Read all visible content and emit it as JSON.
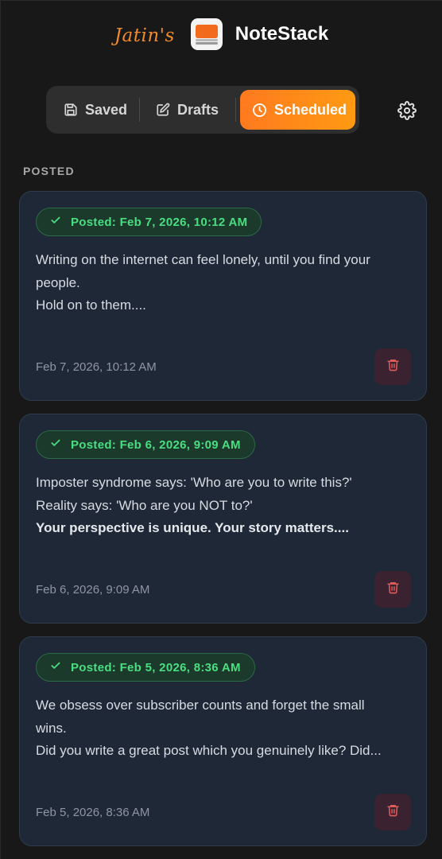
{
  "header": {
    "owner": "Jatin's",
    "title": "NoteStack"
  },
  "tabs": [
    {
      "label": "Saved",
      "icon": "save-icon"
    },
    {
      "label": "Drafts",
      "icon": "edit-icon"
    },
    {
      "label": "Scheduled",
      "icon": "clock-icon",
      "active": true
    }
  ],
  "section_label": "POSTED",
  "colors": {
    "accent": "#ff8a1a",
    "card_bg": "#1f2837",
    "posted_green": "#4ade80",
    "delete_red": "#e05a5a"
  },
  "posts": [
    {
      "status": "Posted: Feb 7, 2026, 10:12 AM",
      "lines": [
        {
          "text": "Writing on the internet can feel lonely, until you find your"
        },
        {
          "text": "people."
        },
        {
          "text": "Hold on to them...."
        }
      ],
      "timestamp": "Feb 7, 2026, 10:12 AM"
    },
    {
      "status": "Posted: Feb 6, 2026, 9:09 AM",
      "lines": [
        {
          "text": "Imposter syndrome says: 'Who are you to write this?'"
        },
        {
          "text": "Reality says: 'Who are you NOT to?'"
        },
        {
          "text": "Your perspective is unique. Your story matters....",
          "bold": true
        }
      ],
      "timestamp": "Feb 6, 2026, 9:09 AM"
    },
    {
      "status": "Posted: Feb 5, 2026, 8:36 AM",
      "lines": [
        {
          "text": "We obsess over subscriber counts and forget the small"
        },
        {
          "text": "wins."
        },
        {
          "text": "Did you write a great post which you genuinely like? Did..."
        }
      ],
      "timestamp": "Feb 5, 2026, 8:36 AM"
    }
  ]
}
